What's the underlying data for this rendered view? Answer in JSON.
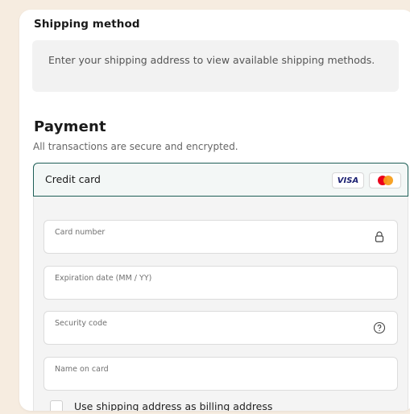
{
  "shipping": {
    "title": "Shipping method",
    "message": "Enter your shipping address to view available shipping methods."
  },
  "payment": {
    "title": "Payment",
    "subtitle": "All transactions are secure and encrypted.",
    "method": {
      "label": "Credit card",
      "brands": [
        "VISA",
        "mastercard-icon"
      ],
      "visa_label": "VISA"
    },
    "fields": {
      "card_number": "Card number",
      "expiration": "Expiration date (MM / YY)",
      "security_code": "Security code",
      "name_on_card": "Name on card"
    },
    "billing_checkbox": {
      "label": "Use shipping address as billing address",
      "checked": false
    }
  },
  "colors": {
    "page_bg": "#f6ece0",
    "accent": "#1e5f57",
    "mastercard_red": "#eb001b",
    "mastercard_orange": "#f79e1b",
    "visa_blue": "#1a1f71"
  }
}
